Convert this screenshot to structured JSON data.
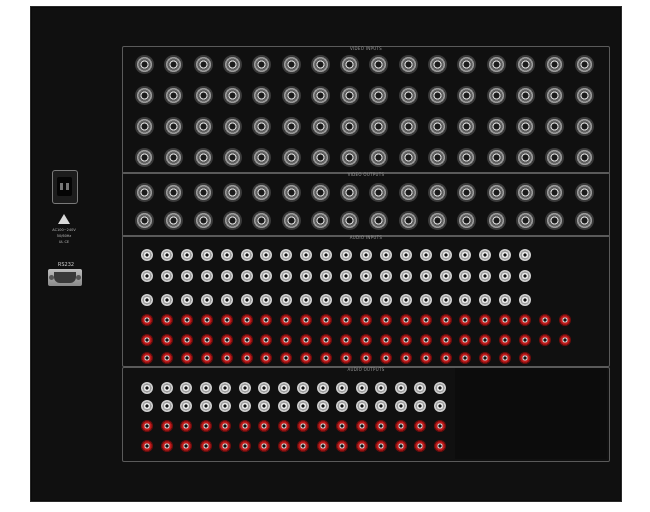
{
  "device": {
    "video_inputs_label": "VIDEO INPUTS",
    "video_outputs_label": "VIDEO OUTPUTS",
    "audio_inputs_label": "AUDIO INPUTS",
    "audio_outputs_label": "AUDIO OUTPUTS",
    "rs232_label": "RS232",
    "power_rating": "AC100~240V",
    "power_freq": "50/60Hz",
    "cert_marks": "UL CE"
  }
}
